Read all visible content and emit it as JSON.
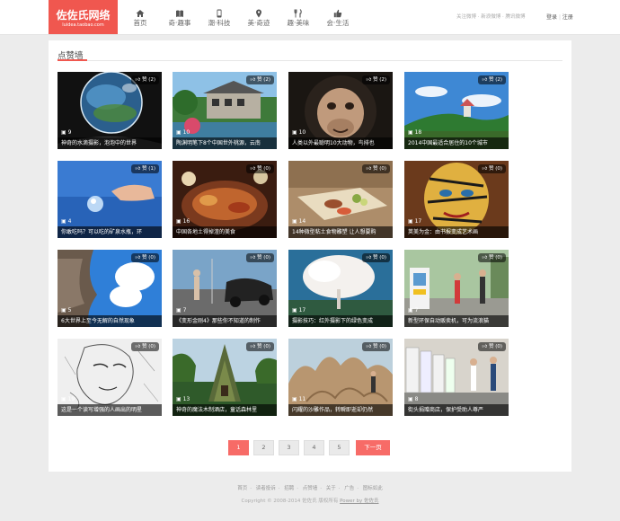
{
  "brand": {
    "name": "佐佐氏网络",
    "sub": "luidea.taobao.com"
  },
  "nav": [
    {
      "label": "首页",
      "icon": "home-icon"
    },
    {
      "label": "奇·趣事",
      "icon": "book-icon"
    },
    {
      "label": "潮·科技",
      "icon": "phone-icon"
    },
    {
      "label": "美·奇迹",
      "icon": "pin-icon"
    },
    {
      "label": "趣·美味",
      "icon": "fork-knife-icon"
    },
    {
      "label": "会·生活",
      "icon": "thumbs-up-icon"
    }
  ],
  "header_right": {
    "links": "关注微博 · 新浪微博 · 腾讯微博",
    "login": "登录",
    "register": "注册"
  },
  "section": {
    "title": "点赞墙"
  },
  "cards": [
    {
      "caption": "神奇的水滴摄影，泡泡中的世界",
      "likes": "赞 (2)",
      "count": "9",
      "scene": "bubble"
    },
    {
      "caption": "陶渊明笔下8个中国世外桃源，云南",
      "likes": "赞 (2)",
      "count": "10",
      "scene": "village"
    },
    {
      "caption": "人类以外最聪明10大动物，鸟排也",
      "likes": "赞 (2)",
      "count": "10",
      "scene": "chimp"
    },
    {
      "caption": "2014中国最适合居住的10个城市",
      "likes": "赞 (2)",
      "count": "18",
      "scene": "city"
    },
    {
      "caption": "你敢吃吗？可以吃的矿泉水瓶，环",
      "likes": "赞 (1)",
      "count": "4",
      "scene": "water"
    },
    {
      "caption": "中国各地土得掉渣的美食",
      "likes": "赞 (0)",
      "count": "16",
      "scene": "food"
    },
    {
      "caption": "14种微型粘土食物雕塑 让人想要购",
      "likes": "赞 (0)",
      "count": "14",
      "scene": "clay"
    },
    {
      "caption": "荚美为金：由书报变成艺术画",
      "likes": "赞 (0)",
      "count": "17",
      "scene": "art"
    },
    {
      "caption": "6大世界上至今无解的自然现象",
      "likes": "赞 (0)",
      "count": "5",
      "scene": "sky"
    },
    {
      "caption": "《变形金刚4》那些你不知道的制作",
      "likes": "赞 (0)",
      "count": "7",
      "scene": "car"
    },
    {
      "caption": "摄影技巧：红外摄影下的绿色变成",
      "likes": "赞 (0)",
      "count": "17",
      "scene": "tree"
    },
    {
      "caption": "新型环保自动贩卖机，可为流浪猫",
      "likes": "赞 (0)",
      "count": "7",
      "scene": "vending"
    },
    {
      "caption": "这是一个读写增强的人画出的明星",
      "likes": "赞 (0)",
      "count": "19",
      "scene": "sketch"
    },
    {
      "caption": "神奇的魔法木制酒店，童话森林里",
      "likes": "赞 (0)",
      "count": "13",
      "scene": "hotel"
    },
    {
      "caption": "闪耀的沙雕作品，转瞬即逝却仍然",
      "likes": "赞 (0)",
      "count": "11",
      "scene": "sand"
    },
    {
      "caption": "街头捐赠商店，保护受助人尊严",
      "likes": "赞 (0)",
      "count": "8",
      "scene": "street"
    }
  ],
  "pagination": {
    "pages": [
      "1",
      "2",
      "3",
      "4",
      "5"
    ],
    "current": "1",
    "next": "下一页"
  },
  "footer": {
    "links": [
      "首页",
      "读者投诉",
      "招聘",
      "点赞墙",
      "关于",
      "广告",
      "图标如此"
    ],
    "copyright": "Copyright © 2008-2014 佐佐氏 版权所有",
    "powered": "Power by 佐佐氏"
  },
  "colors": {
    "accent": "#f0574f",
    "pager_active": "#f76b67",
    "background": "#ececec"
  }
}
